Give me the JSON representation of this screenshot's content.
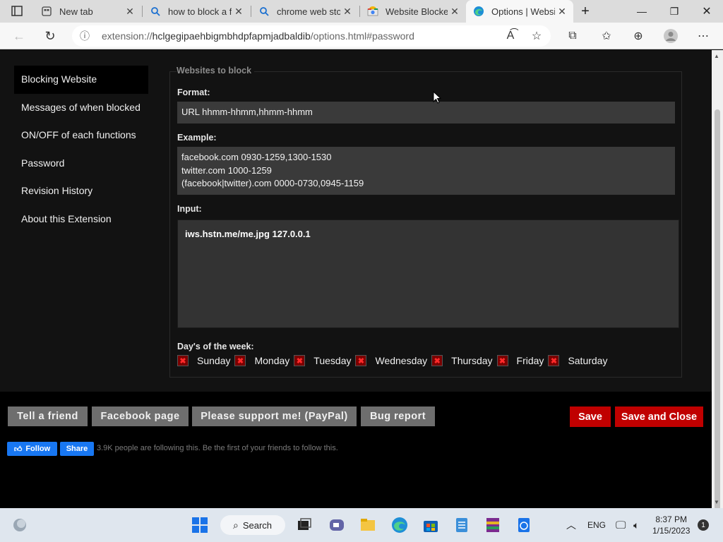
{
  "browser": {
    "tabs": [
      {
        "title": "New tab",
        "icon": "new-tab-icon"
      },
      {
        "title": "how to block a f",
        "icon": "search-icon"
      },
      {
        "title": "chrome web stor",
        "icon": "search-icon"
      },
      {
        "title": "Website Blocker",
        "icon": "chrome-store-icon"
      },
      {
        "title": "Options | Websi",
        "icon": "edge-icon"
      }
    ],
    "url_prefix": "extension://",
    "url_host": "hclgegipaehbigmbhdpfapmjadbaldib",
    "url_path": "/options.html#password"
  },
  "sidebar": {
    "items": [
      {
        "label": "Blocking Website"
      },
      {
        "label": "Messages of when blocked"
      },
      {
        "label": "ON/OFF of each functions"
      },
      {
        "label": "Password"
      },
      {
        "label": "Revision History"
      },
      {
        "label": "About this Extension"
      }
    ]
  },
  "form": {
    "legend": "Websites to block",
    "format_label": "Format:",
    "format_value": "URL hhmm-hhmm,hhmm-hhmm",
    "example_label": "Example:",
    "examples": [
      "facebook.com 0930-1259,1300-1530",
      "twitter.com 1000-1259",
      "(facebook|twitter).com 0000-0730,0945-1159"
    ],
    "input_label": "Input:",
    "input_value": "iws.hstn.me/me.jpg 127.0.0.1",
    "days_label": "Day's of the week:",
    "days": [
      "Sunday",
      "Monday",
      "Tuesday",
      "Wednesday",
      "Thursday",
      "Friday",
      "Saturday"
    ]
  },
  "footer": {
    "tell_friend": "Tell a friend",
    "facebook_page": "Facebook page",
    "support": "Please support me! (PayPal)",
    "bug_report": "Bug report",
    "save": "Save",
    "save_close": "Save and Close",
    "fb_follow": "Follow",
    "fb_share": "Share",
    "fb_text": "3.9K people are following this. Be the first of your friends to follow this."
  },
  "taskbar": {
    "search": "Search",
    "lang": "ENG",
    "time": "8:37 PM",
    "date": "1/15/2023",
    "notifications": "1"
  },
  "colors": {
    "accent_red": "#c00000",
    "checkbox_red": "#7a0000",
    "page_bg": "#121212",
    "facebook_blue": "#1877f2"
  }
}
